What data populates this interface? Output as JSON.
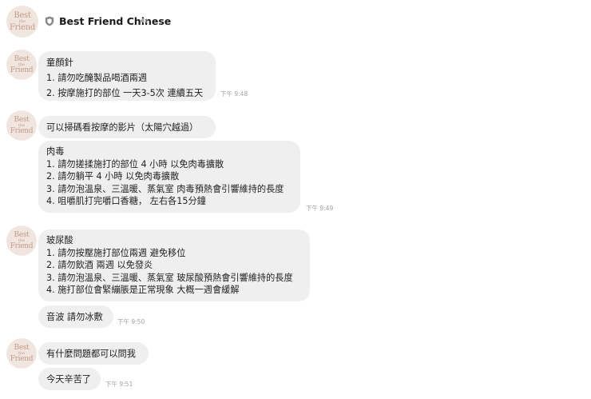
{
  "header": {
    "logo_text": [
      "Best",
      "the",
      "Friend"
    ],
    "title": "Best Friend Chinese"
  },
  "messages": [
    {
      "lines": [
        "童顏針",
        "1. 請勿吃醃製品喝酒兩週",
        "2. 按摩施打的部位 一天3-5次 連續五天"
      ],
      "time": "下午 9:48"
    },
    {
      "lines": [
        "可以掃碼看按摩的影片（太陽穴越過）"
      ]
    },
    {
      "lines": [
        "肉毒",
        "1. 請勿搓揉施打的部位 4 小時 以免肉毒擴散",
        "2. 請勿躺平 4 小時 以免肉毒擴散",
        "3. 請勿泡溫泉、三溫暖、蒸氣室 肉毒預熱會引響維持的長度",
        "4. 咀嚼肌打完嚼口香糖，  左右各15分鐘"
      ],
      "time": "下午 9:49"
    },
    {
      "lines": [
        "玻尿酸",
        "1. 請勿按壓施打部位兩週 避免移位",
        "2. 請勿飲酒 兩週 以免發炎",
        "3. 請勿泡溫泉、三溫暖、蒸氣室 玻尿酸預熱會引響維持的長度",
        "4. 施打部位會緊繃脹是正常現象 大概一週會緩解"
      ]
    },
    {
      "lines": [
        "音波 請勿冰敷"
      ],
      "time": "下午 9:50"
    },
    {
      "lines": [
        "有什麼問題都可以問我"
      ]
    },
    {
      "lines": [
        "今天辛苦了"
      ],
      "time": "下午 9:51"
    }
  ],
  "colors": {
    "bubble": "#efefef",
    "avatar_bg": "#f1e6df",
    "avatar_text": "#c39a8a",
    "time": "#a0a0a0"
  },
  "icons": {
    "header_badge": "shield-icon",
    "mute": "speaker-icon"
  }
}
